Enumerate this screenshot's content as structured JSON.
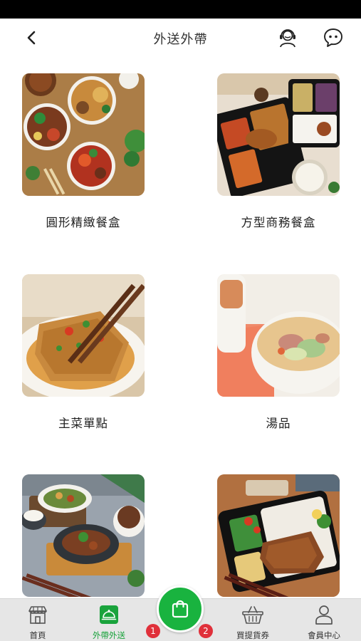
{
  "nav": {
    "title": "外送外帶"
  },
  "categories": [
    {
      "label": "圓形精緻餐盒"
    },
    {
      "label": "方型商務餐盒"
    },
    {
      "label": "主菜單點"
    },
    {
      "label": "湯品"
    },
    {
      "label": ""
    },
    {
      "label": ""
    }
  ],
  "tabbar": {
    "items": [
      {
        "label": "首頁",
        "icon": "storefront-icon"
      },
      {
        "label": "外帶外送",
        "icon": "cloche-icon",
        "active": true
      },
      {
        "label": "買提貨券",
        "icon": "basket-icon"
      },
      {
        "label": "會員中心",
        "icon": "person-icon"
      }
    ],
    "cart_badges": [
      "1",
      "2"
    ]
  },
  "colors": {
    "accent": "#19b33f",
    "badge": "#e0303a",
    "tabbar_bg": "#e6e6e6"
  }
}
